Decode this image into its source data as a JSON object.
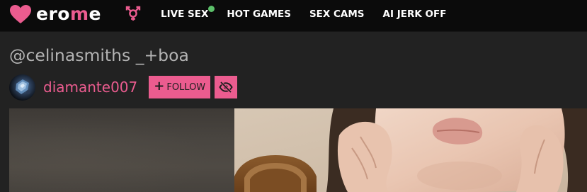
{
  "brand": {
    "logo_text_white_1": "ero",
    "logo_text_accent": "m",
    "logo_text_white_2": "e",
    "accent_color": "#eb5c8f"
  },
  "nav": {
    "gender_icon": "gender-symbol-icon",
    "links": [
      {
        "label": "LIVE SEX",
        "live_indicator": true,
        "indicator_color": "#5cc06a"
      },
      {
        "label": "HOT GAMES"
      },
      {
        "label": "SEX CAMS"
      },
      {
        "label": "AI JERK OFF"
      }
    ]
  },
  "album": {
    "title": "@celinasmiths _+boa"
  },
  "uploader": {
    "avatar_icon": "avatar-image",
    "username": "diamante007",
    "follow_label": "FOLLOW",
    "hide_icon": "eye-slash-icon"
  },
  "media": {
    "items": [
      "blurred-video-thumbnail",
      "photo"
    ]
  }
}
